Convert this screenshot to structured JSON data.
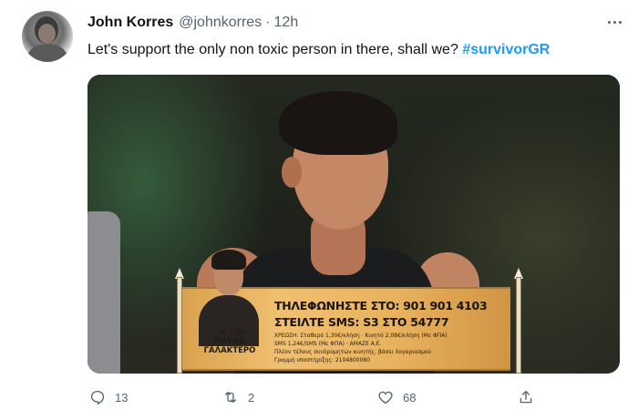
{
  "tweet": {
    "author": {
      "name": "John Korres",
      "handle": "@johnkorres",
      "separator": "·",
      "time": "12h"
    },
    "text_prefix": "Let's support the only non toxic person in there, shall we? ",
    "hashtag": "#survivorGR",
    "media": {
      "banner": {
        "for_line1": "ΓΙΑ ΤΟΝ",
        "for_line2": "ΠΑΥΛΟ",
        "for_line3": "ΓΑΛΑΚΤΕΡΟ",
        "phone_line": "ΤΗΛΕΦΩΝΗΣΤΕ ΣΤΟ: 901 901 4103",
        "sms_line": "ΣΤΕΙΛΤΕ SMS:  S3   ΣΤΟ   54777",
        "fine_line1": "ΧΡΕΩΣΗ: Σταθερό 1,30€/κλήση · Κινητό 2,08€/κλήση (Με ΦΠΑ)",
        "fine_line2": "SMS 1,24€/SMS (Με ΦΠΑ) · AMAZE A.E.",
        "fine_line3": "Πλέον τέλους συνδρομητών κινητής, βάσει λογαριασμού",
        "fine_line4": "Γραμμή υποστήριξης: 2104800080"
      }
    },
    "actions": {
      "reply_count": "13",
      "retweet_count": "2",
      "like_count": "68"
    },
    "colors": {
      "hashtag": "#1d9bf0",
      "muted": "#536471",
      "text": "#0f1419"
    }
  }
}
